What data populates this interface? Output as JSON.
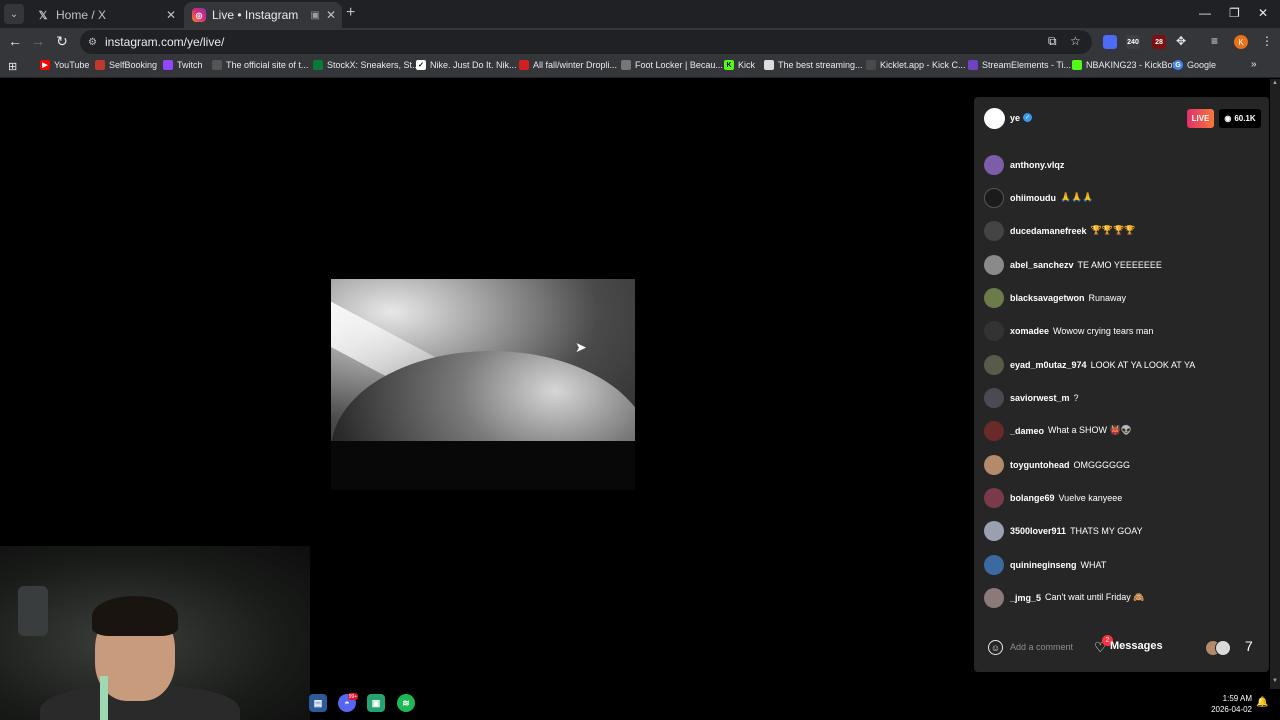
{
  "tabs": [
    {
      "label": "Home / X",
      "icon": "x-logo-icon"
    },
    {
      "label": "Live • Instagram",
      "icon": "instagram-icon"
    }
  ],
  "address_bar": {
    "url": "instagram.com/ye/live/"
  },
  "extensions": [
    {
      "badge": "",
      "color": "#4a6cf7"
    },
    {
      "badge": "240",
      "color": "#3c4043"
    },
    {
      "badge": "28",
      "color": "#7a1212"
    }
  ],
  "profile_initial": "K",
  "bookmarks": [
    {
      "label": "YouTube",
      "color": "#ff0000"
    },
    {
      "label": "SelfBooking",
      "color": "#c0392b"
    },
    {
      "label": "Twitch",
      "color": "#9146ff"
    },
    {
      "label": "The official site of t...",
      "color": "#555555"
    },
    {
      "label": "StockX: Sneakers, St...",
      "color": "#0a7a3a"
    },
    {
      "label": "Nike. Just Do It. Nik...",
      "color": "#ffffff"
    },
    {
      "label": "All fall/winter Dropli...",
      "color": "#d21f1f"
    },
    {
      "label": "Foot Locker | Becau...",
      "color": "#777777"
    },
    {
      "label": "Kick",
      "color": "#53fc18"
    },
    {
      "label": "The best streaming...",
      "color": "#dddddd"
    },
    {
      "label": "Kicklet.app - Kick C...",
      "color": "#4a4a4a"
    },
    {
      "label": "StreamElements - Ti...",
      "color": "#6f42c1"
    },
    {
      "label": "NBAKING23 - KickBot",
      "color": "#53fc18"
    },
    {
      "label": "Google",
      "color": "#4285f4"
    }
  ],
  "live": {
    "host": "ye",
    "live_label": "LIVE",
    "viewers": "60.1K"
  },
  "comments": [
    {
      "user": "anthony.vlqz",
      "text": "",
      "color": "#7b5ea7"
    },
    {
      "user": "ohiimoudu",
      "text": "🙏🙏🙏",
      "color": "#1b1b1b"
    },
    {
      "user": "ducedamanefreek",
      "text": "🏆🏆🏆🏆",
      "color": "#444444"
    },
    {
      "user": "abel_sanchezv",
      "text": "TE AMO YEEEEEEE",
      "color": "#8a8a8a"
    },
    {
      "user": "blacksavagetwon",
      "text": "Runaway",
      "color": "#6b7b4a"
    },
    {
      "user": "xomadee",
      "text": "Wowow crying tears man",
      "color": "#333333"
    },
    {
      "user": "eyad_m0utaz_974",
      "text": "LOOK AT YA LOOK AT YA",
      "color": "#5a5a4a"
    },
    {
      "user": "saviorwest_m",
      "text": "?",
      "color": "#4a4a55"
    },
    {
      "user": "_dameo",
      "text": "What a SHOW 👹👽",
      "color": "#6a2a2a"
    },
    {
      "user": "toyguntohead",
      "text": "OMGGGGGG",
      "color": "#b48a6a"
    },
    {
      "user": "bolange69",
      "text": "Vuelve kanyeee",
      "color": "#7a3a4a"
    },
    {
      "user": "3500lover911",
      "text": "THATS MY GOAY",
      "color": "#9aa0b0"
    },
    {
      "user": "quinineginseng",
      "text": "WHAT",
      "color": "#3a6aa0"
    },
    {
      "user": "_jmg_5",
      "text": "Can't wait until Friday 🙈",
      "color": "#8a7a7a"
    }
  ],
  "composer": {
    "placeholder": "Add a comment"
  },
  "messages": {
    "label": "Messages",
    "badge": "2"
  },
  "taskbar": {
    "discord_badge": "99+",
    "time": "1:59 AM",
    "date": "2026-04-02"
  }
}
